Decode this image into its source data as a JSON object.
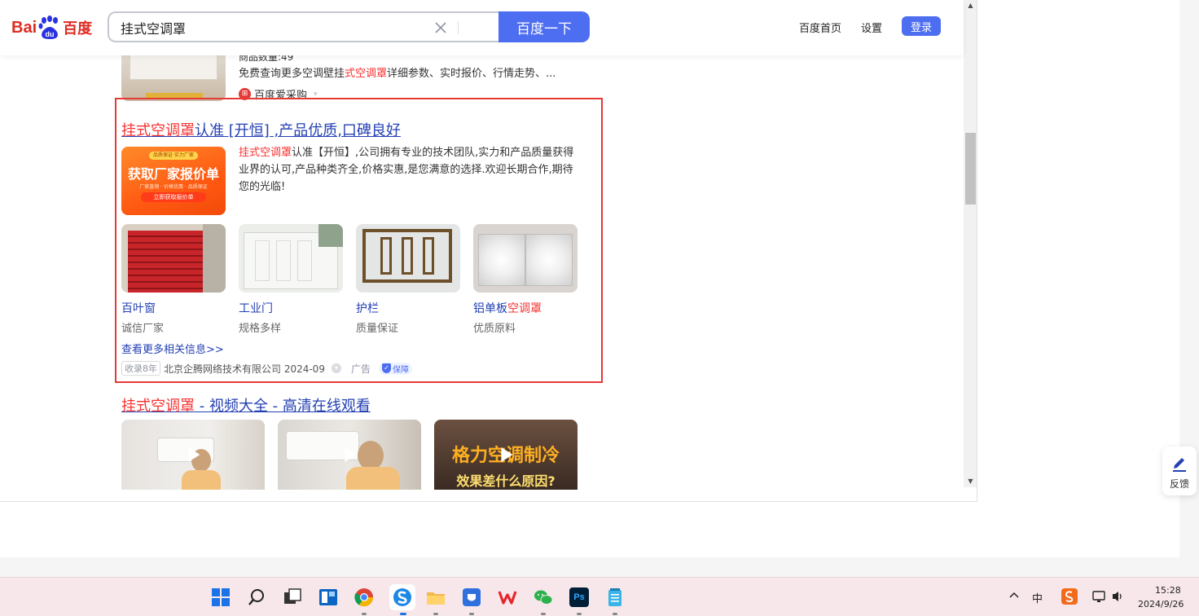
{
  "header": {
    "logo_text": "Bai",
    "logo_du": "du",
    "logo_cn": "百度",
    "search_value": "挂式空调罩",
    "search_button": "百度一下",
    "links": [
      "百度首页",
      "设置"
    ],
    "login": "登录"
  },
  "prev_result": {
    "count_text": "商品数量:49",
    "desc_prefix": "免费查询更多空调壁挂",
    "desc_hl": "式空调罩",
    "desc_suffix": "详细参数、实时报价、行情走势、...",
    "source": "百度爱采购"
  },
  "ad": {
    "title_hl": "挂式空调罩",
    "title_rest": "认准 [开恒] ,产品优质,口碑良好",
    "banner_top": "品质保证·实力厂家",
    "banner_main": "获取厂家报价单",
    "banner_sub": "厂家直销 · 价格优惠 · 品质保证",
    "banner_btn": "立即获取报价单",
    "desc_hl": "挂式空调罩",
    "desc_rest": "认准【开恒】,公司拥有专业的技术团队,实力和产品质量获得业界的认可,产品种类齐全,价格实惠,是您满意的选择.欢迎长期合作,期待您的光临!",
    "products": [
      {
        "name": "百叶窗",
        "name_hl": "",
        "sub": "诚信厂家"
      },
      {
        "name": "工业门",
        "name_hl": "",
        "sub": "规格多样"
      },
      {
        "name": "护栏",
        "name_hl": "",
        "sub": "质量保证"
      },
      {
        "name": "铝单板",
        "name_hl": "空调罩",
        "sub": "优质原料"
      }
    ],
    "more_link": "查看更多相关信息>>",
    "badge_years": "收录8年",
    "company": "北京企腾网络技术有限公司 2024-09",
    "ad_label": "广告",
    "guarantee": "保障"
  },
  "video_result": {
    "title_hl": "挂式空调罩",
    "title_rest": " - 视频大全 - 高清在线观看",
    "thumb3_text1": "格力空调制冷",
    "thumb3_text2": "效果差什么原因?"
  },
  "feedback_label": "反馈",
  "taskbar": {
    "time": "15:28",
    "date": "2024/9/26",
    "ime": "中",
    "ps_label": "Ps"
  }
}
